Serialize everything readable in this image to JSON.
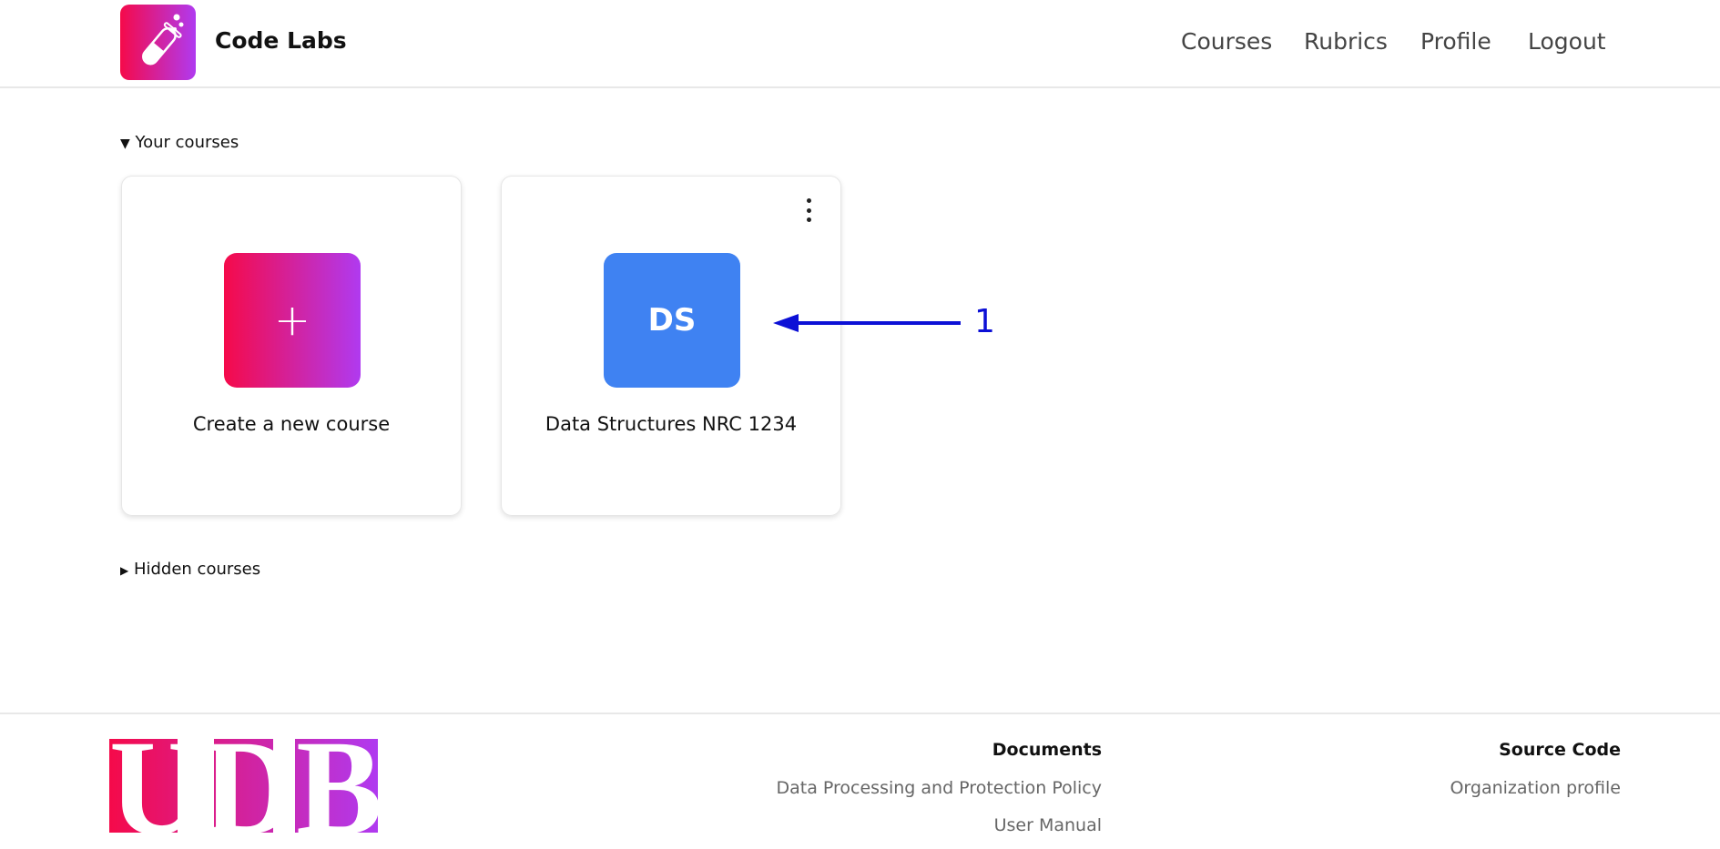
{
  "header": {
    "brand": "Code Labs",
    "logo_icon": "test-tube-icon",
    "nav": [
      "Courses",
      "Rubrics",
      "Profile",
      "Logout"
    ]
  },
  "main": {
    "your_courses": "Your courses",
    "hidden_courses": "Hidden courses",
    "cards": [
      {
        "icon": "+",
        "label": "Create a new course"
      },
      {
        "icon": "DS",
        "label": "Data Structures NRC 1234",
        "color": "#3f82f2"
      }
    ]
  },
  "annotation": {
    "label": "1",
    "color": "#0c10d6"
  },
  "footer": {
    "logo_text": "UDB",
    "documents": {
      "title": "Documents",
      "links": [
        "Data Processing and Protection Policy",
        "User Manual"
      ]
    },
    "source": {
      "title": "Source Code",
      "links": [
        "Organization profile"
      ]
    }
  },
  "colors": {
    "gradient_start": "#f50a4a",
    "gradient_end": "#b03af0"
  }
}
